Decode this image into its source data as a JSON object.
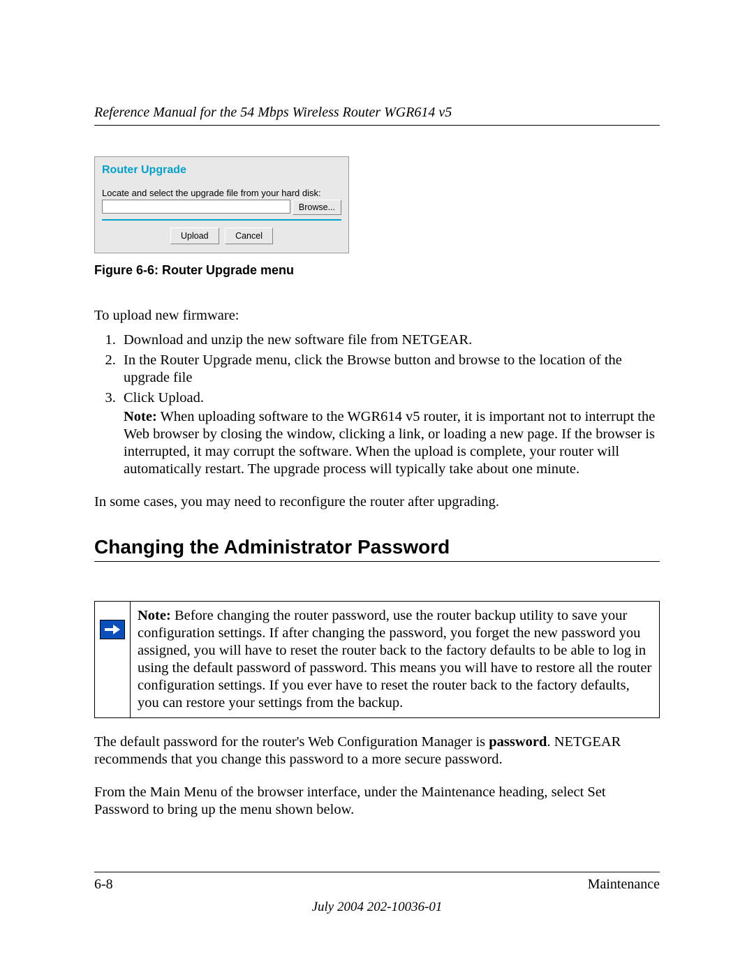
{
  "header": {
    "running_head": "Reference Manual for the 54 Mbps Wireless Router WGR614 v5"
  },
  "screenshot": {
    "title": "Router Upgrade",
    "instruction": "Locate and select the upgrade file from your hard disk:",
    "browse_label": "Browse...",
    "upload_label": "Upload",
    "cancel_label": "Cancel"
  },
  "figure_caption": "Figure 6-6:  Router Upgrade menu",
  "intro_text": "To upload new firmware:",
  "steps": {
    "s1": "Download and unzip the new software file from NETGEAR.",
    "s2": "In the Router Upgrade menu, click the Browse button and browse to the location of the upgrade file",
    "s3": "Click Upload.",
    "s3_note_label": "Note:",
    "s3_note_body": " When uploading software to the WGR614 v5 router, it is important not to interrupt the Web browser by closing the window, clicking a link, or loading a new page. If the browser is interrupted, it may corrupt the software. When the upload is complete, your router will automatically restart. The upgrade process will typically take about one minute."
  },
  "post_list_para": "In some cases, you may need to reconfigure the router after upgrading.",
  "section_heading": "Changing the Administrator Password",
  "note_box": {
    "label": "Note:",
    "body": " Before changing the router password, use the router backup utility to save your configuration settings. If after changing the password, you forget the new password you assigned, you will have to reset the router back to the factory defaults to be able to log in using the default password of password. This means you will have to restore all the router configuration settings. If you ever have to reset the router back to the factory defaults, you can restore your settings from the backup."
  },
  "para_after_note_pre": "The default password for the router's Web Configuration Manager is ",
  "para_after_note_bold": "password",
  "para_after_note_post": ". NETGEAR recommends that you change this password to a more secure password.",
  "para_last": "From the Main Menu of the browser interface, under the Maintenance heading, select Set Password to bring up the menu shown below.",
  "footer": {
    "page_number": "6-8",
    "section": "Maintenance",
    "date_line": "July 2004 202-10036-01"
  }
}
